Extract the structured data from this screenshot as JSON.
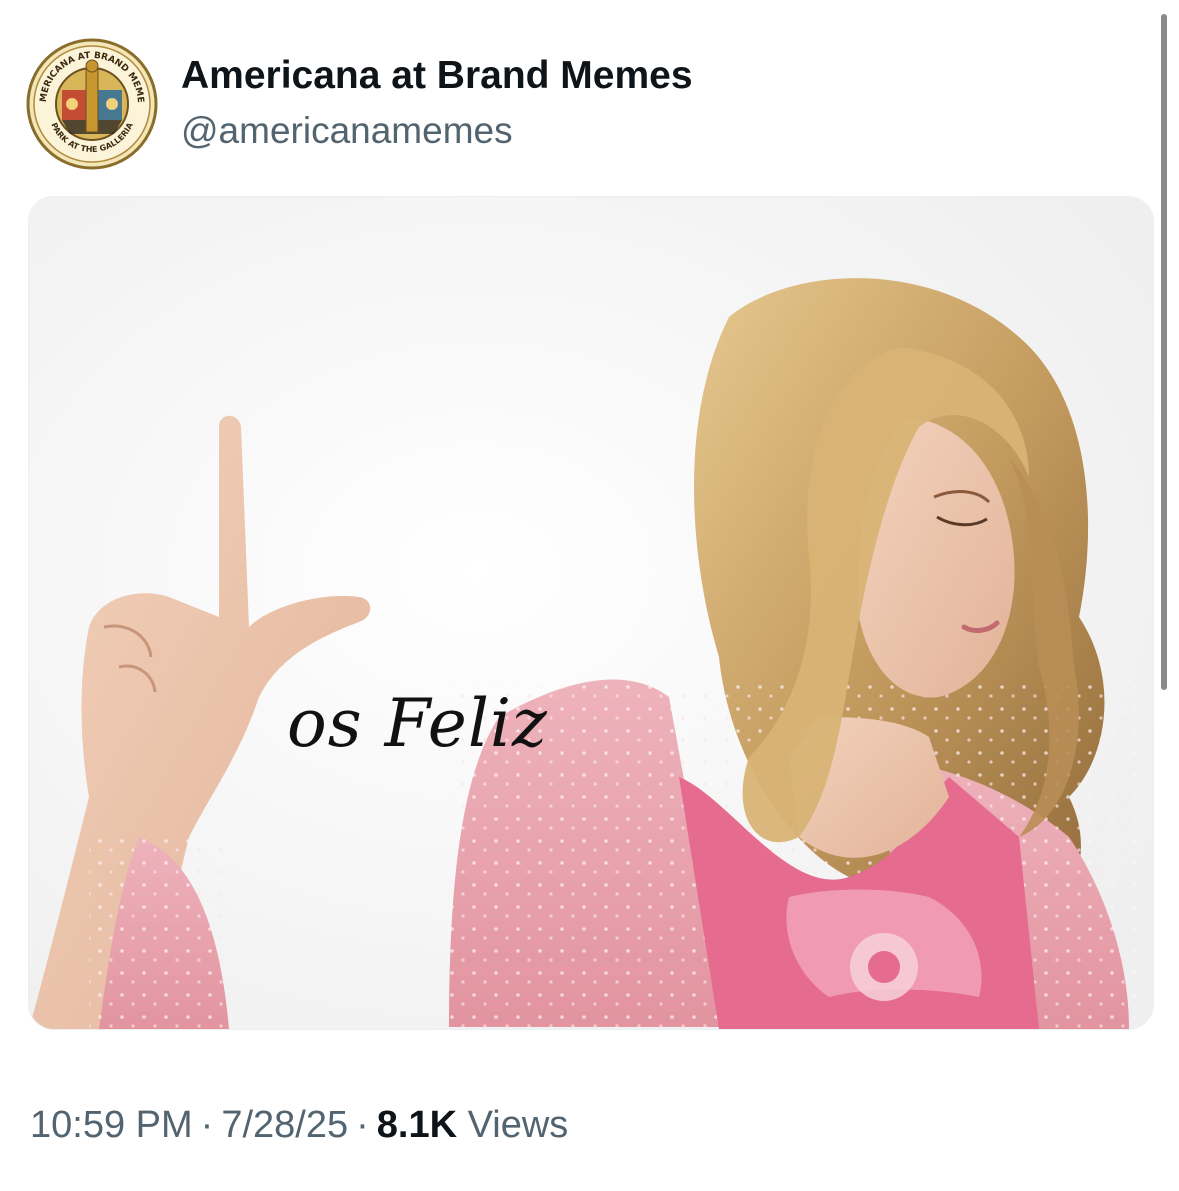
{
  "author": {
    "name": "Americana at Brand Memes",
    "handle": "@americanamemes",
    "avatar_seal_text_top": "AMERICANA AT BRAND MEMES",
    "avatar_seal_text_bottom": "PARK AT THE GALLERIA"
  },
  "post": {
    "image_caption": "os Feliz"
  },
  "meta": {
    "time": "10:59 PM",
    "separator": "·",
    "date": "7/28/25",
    "views_count": "8.1K",
    "views_label": "Views"
  },
  "colors": {
    "name_text": "#0f1419",
    "secondary_text": "#536471",
    "cardigan_pink": "#e9a4ae",
    "top_pink": "#e56b8f",
    "hair_blonde": "#c9a065"
  }
}
